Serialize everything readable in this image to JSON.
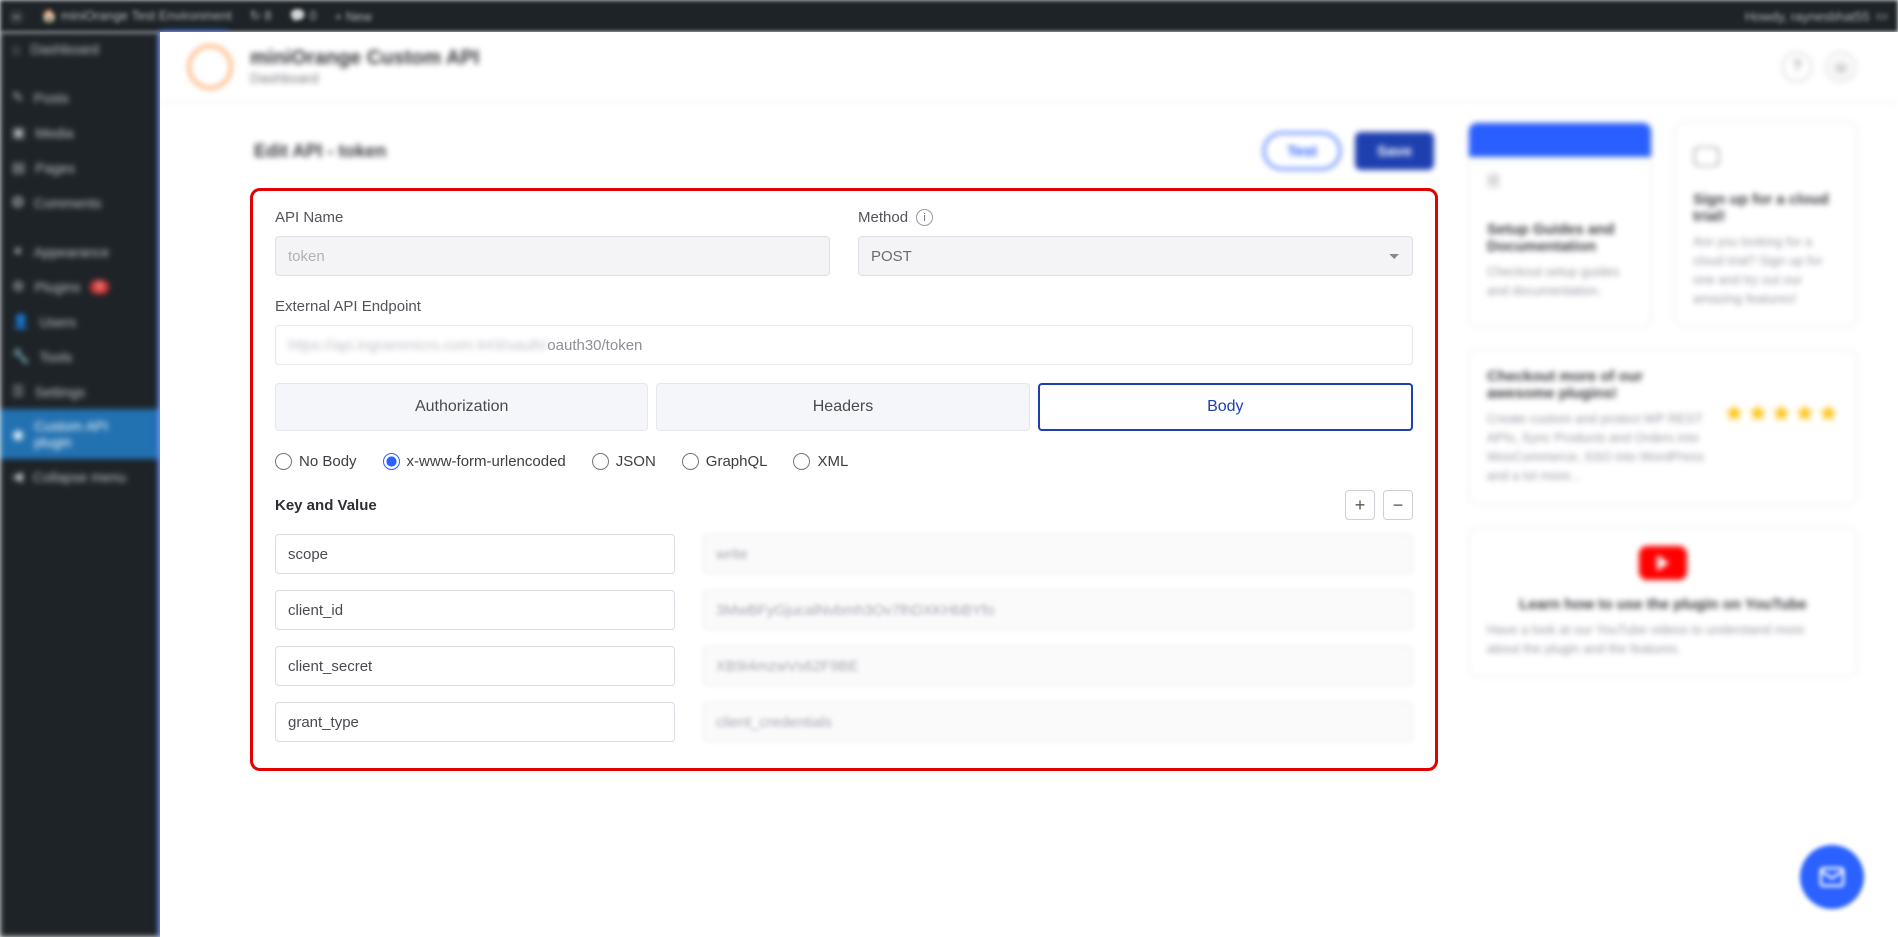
{
  "adminbar": {
    "site": "miniOrange Test Environment",
    "updates": "8",
    "comments": "0",
    "new": "New",
    "howdy": "Howdy, raynesbhat55"
  },
  "wpmenu": {
    "items": [
      {
        "label": "Dashboard"
      },
      {
        "label": "Posts"
      },
      {
        "label": "Media"
      },
      {
        "label": "Pages"
      },
      {
        "label": "Comments"
      },
      {
        "label": "Appearance"
      },
      {
        "label": "Plugins",
        "badge": "5"
      },
      {
        "label": "Users"
      },
      {
        "label": "Tools"
      },
      {
        "label": "Settings"
      },
      {
        "label": "Custom API plugin",
        "current": true
      },
      {
        "label": "Collapse menu"
      }
    ]
  },
  "header": {
    "title": "miniOrange Custom API",
    "subtitle": "Dashboard"
  },
  "card": {
    "title": "Edit API - token",
    "test_label": "Test",
    "save_label": "Save"
  },
  "form": {
    "api_name_label": "API Name",
    "api_name_value": "token",
    "method_label": "Method",
    "method_value": "POST",
    "endpoint_label": "External API Endpoint",
    "endpoint_blurred": "https://api.ingrammicro.com:443/oauth/",
    "endpoint_clear": "oauth30/token",
    "tabs": {
      "auth": "Authorization",
      "headers": "Headers",
      "body": "Body"
    },
    "body_types": {
      "none": "No Body",
      "form": "x-www-form-urlencoded",
      "json": "JSON",
      "graphql": "GraphQL",
      "xml": "XML"
    },
    "kv_title": "Key and Value",
    "kv": [
      {
        "key": "scope",
        "value": "write"
      },
      {
        "key": "client_id",
        "value": "3MwBFyGjucalNvbmh3Ov7lhDXKHbBYfo"
      },
      {
        "key": "client_secret",
        "value": "XB9i4mzwVs62F9BE"
      },
      {
        "key": "grant_type",
        "value": "client_credentials"
      }
    ]
  },
  "side": {
    "setup_title": "Setup Guides and Documentation",
    "setup_text": "Checkout setup guides and documentation.",
    "trial_title": "Sign up for a cloud trial!",
    "trial_text": "Are you looking for a cloud trial? Sign up for one and try out our amazing features!",
    "plugins_title": "Checkout more of our awesome plugins!",
    "plugins_text": "Create custom and protect WP REST APIs, Sync Products and Orders into WooCommerce, SSO into WordPress and a lot more...",
    "yt_title": "Learn how to use the plugin on YouTube",
    "yt_text": "Have a look at our YouTube videos to understand more about the plugin and the features."
  }
}
